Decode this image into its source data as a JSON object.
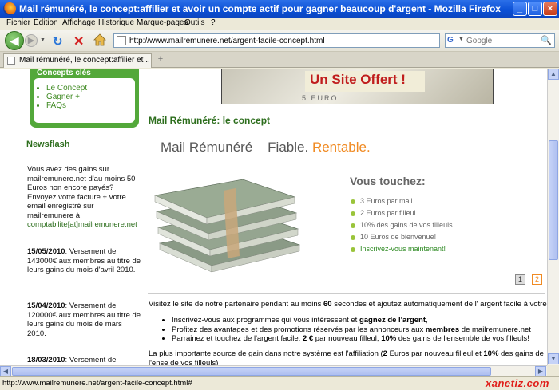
{
  "window": {
    "title": "Mail rémunéré, le concept:affilier et avoir un compte actif pour gagner beaucoup d'argent - Mozilla Firefox",
    "buttons": {
      "minimize": "_",
      "maximize": "□",
      "close": "×"
    }
  },
  "menu": [
    "Fichier",
    "Édition",
    "Affichage",
    "Historique",
    "Marque-pages",
    "Outils",
    "?"
  ],
  "toolbar": {
    "url": "http://www.mailremunere.net/argent-facile-concept.html",
    "search_placeholder": "Google"
  },
  "tab": {
    "label": "Mail rémunéré, le concept:affilier et ...",
    "new_tab": "+"
  },
  "sidebar": {
    "concepts_title": "Concepts clés",
    "concepts_items": [
      "Le Concept",
      "Gagner +",
      "FAQs"
    ],
    "newsflash_title": "Newsflash",
    "news": [
      {
        "text": "Vous avez des gains sur mailremunere.net d'au moins 50 Euros non encore payés? Envoyez votre facture + votre email enregistré sur mailremunere à",
        "email": "comptabilite[at]mailremunere.net"
      },
      {
        "date": "15/05/2010",
        "text": ": Versement de 143000€ aux membres au titre de leurs gains du mois d'avril 2010."
      },
      {
        "date": "15/04/2010",
        "text": ": Versement de 120000€ aux membres au titre de leurs gains du mois de mars 2010."
      },
      {
        "date": "18/03/2010",
        "text": ": Versement de"
      }
    ]
  },
  "main": {
    "banner": "Un Site Offert !",
    "banner_bill": "5 EURO",
    "heading": "Mail Rémunéré: le concept",
    "brand_part1": "Mail Rémunéré",
    "brand_part2": "Fiable.",
    "brand_part3": "Rentable.",
    "touchez_title": "Vous touchez:",
    "touchez_items": [
      "3 Euros par mail",
      "2 Euros par filleul",
      "10% des gains de vos filleuls",
      "10 Euros de bienvenue!",
      "Inscrivez-vous maintenant!"
    ],
    "pager": [
      "1",
      "2"
    ],
    "visit_pre": "Visitez le site de notre partenaire pendant au moins ",
    "visit_num": "60",
    "visit_post": " secondes et ajoutez automatiquement de l' argent facile à votre compt",
    "list_items": [
      {
        "pre": "Inscrivez-vous aux programmes qui vous intéressent et ",
        "bold": "gagnez de l'argent",
        "post": ","
      },
      {
        "pre": "Profitez des avantages et des promotions réservés par les annonceurs aux ",
        "bold": "membres",
        "post": " de mailremunere.net"
      },
      {
        "pre": "Parrainez et touchez de l'argent facile: ",
        "bold": "2 €",
        "post": " par nouveau filleul, ",
        "bold2": "10%",
        "post2": " des gains de l'ensemble de vos filleuls!"
      }
    ],
    "para_pre": "La plus importante source de gain dans notre système est l'affiliation (",
    "para_b1": "2",
    "para_mid": " Euros par nouveau filleul et ",
    "para_b2": "10%",
    "para_post": " des gains de l'ense de vos filleuls)"
  },
  "status": {
    "text": "http://www.mailremunere.net/argent-facile-concept.html#",
    "watermark": "xanetiz.com"
  }
}
